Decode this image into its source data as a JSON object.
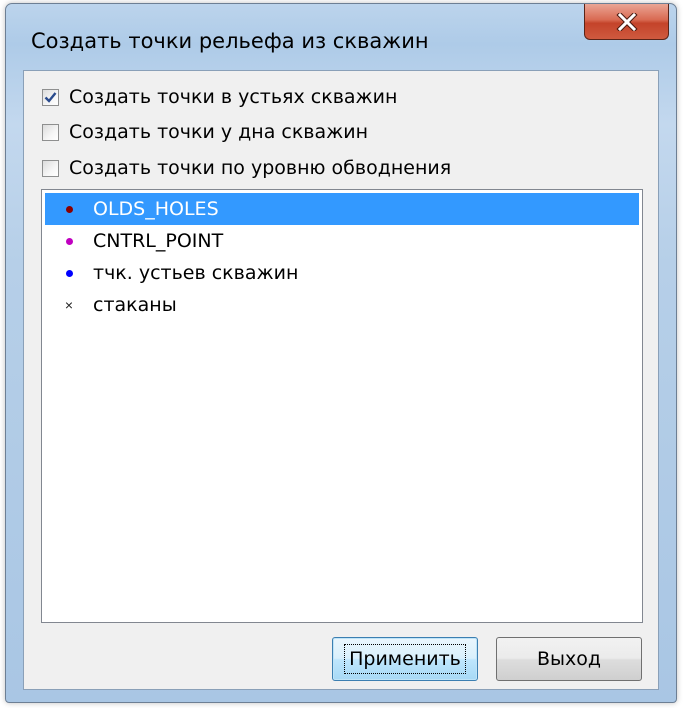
{
  "window": {
    "title": "Создать точки рельефа из скважин",
    "close_icon": "close-icon"
  },
  "options": [
    {
      "label": "Создать точки в устьях скважин",
      "checked": true
    },
    {
      "label": "Создать точки у дна скважин",
      "checked": false
    },
    {
      "label": "Создать точки по уровню обводнения",
      "checked": false
    }
  ],
  "layers": [
    {
      "label": "OLDS_HOLES",
      "marker": "dot",
      "color": "#8b0000",
      "selected": true
    },
    {
      "label": "CNTRL_POINT",
      "marker": "dot",
      "color": "#c000c0",
      "selected": false
    },
    {
      "label": "тчк. устьев скважин",
      "marker": "dot",
      "color": "#0000ff",
      "selected": false
    },
    {
      "label": "стаканы",
      "marker": "x",
      "color": "#222222",
      "selected": false
    }
  ],
  "buttons": {
    "apply_label": "Применить",
    "exit_label": "Выход"
  },
  "colors": {
    "selection": "#3399ff",
    "close_button": "#c4432a"
  }
}
